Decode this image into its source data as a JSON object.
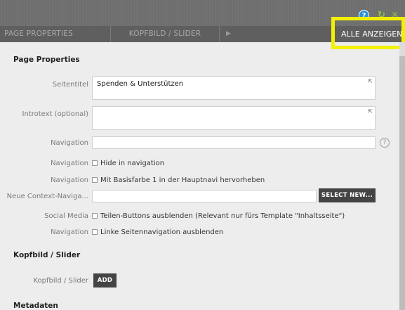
{
  "toolbar": {
    "help_icon": "?",
    "refresh_icon": "↻",
    "close_icon": "✕"
  },
  "tabs": [
    {
      "label": "PAGE PROPERTIES"
    },
    {
      "label": "KOPFBILD / SLIDER"
    },
    {
      "label": "▶"
    }
  ],
  "show_all_label": "ALLE ANZEIGEN",
  "sections": {
    "page_properties": "Page Properties",
    "kopfbild": "Kopfbild / Slider",
    "metadaten": "Metadaten"
  },
  "fields": {
    "seitentitel": {
      "label": "Seitentitel",
      "value": "Spenden & Unterstützen"
    },
    "introtext": {
      "label": "Introtext (optional)",
      "value": ""
    },
    "navigation": {
      "label": "Navigation",
      "value": "",
      "help": "?"
    },
    "hide_in_nav": {
      "label": "Navigation",
      "text": "Hide in navigation",
      "checked": false
    },
    "basisfarbe": {
      "label": "Navigation",
      "text": "Mit Basisfarbe 1 in der Hauptnavi hervorheben",
      "checked": false
    },
    "context_nav": {
      "label": "Neue Context-Naviga...",
      "value": "",
      "button": "SELECT NEW..."
    },
    "social_media": {
      "label": "Social Media",
      "text": "Teilen-Buttons ausblenden (Relevant nur fürs Template \"Inhaltsseite\")",
      "checked": false
    },
    "linke_nav": {
      "label": "Navigation",
      "text": "Linke Seitennavigation ausblenden",
      "checked": false
    },
    "kopfbild_slider": {
      "label": "Kopfbild / Slider",
      "button": "ADD"
    }
  },
  "colors": {
    "highlight": "#f3f000",
    "accent_green": "#8ec33b",
    "help_blue": "#2a8ed3"
  }
}
